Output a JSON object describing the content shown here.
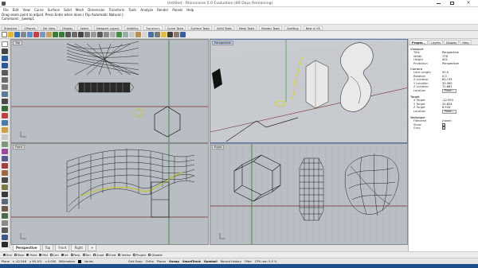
{
  "window": {
    "title": "Untitled - Rhinoceros 5.0 Evaluation (89 Days Remaining)"
  },
  "menu": [
    "File",
    "Edit",
    "View",
    "Curve",
    "Surface",
    "Solid",
    "Mesh",
    "Dimension",
    "Transform",
    "Tools",
    "Analyze",
    "Render",
    "Panels",
    "Help"
  ],
  "command_history": [
    "Drag seam point to adjust. Press Enter when done ( Flip  Automatic  Natural ):",
    "Command: _Sweep1"
  ],
  "toolbar_tabs": [
    "Standard",
    "CPlanes",
    "Set View",
    "Display",
    "Select",
    "Viewport Layout",
    "Visibility",
    "Transform",
    "Curve Tools",
    "Surface Tools",
    "Solid Tools",
    "Mesh Tools",
    "Render Tools",
    "Drafting",
    "New in V5"
  ],
  "viewports": {
    "top": "Top",
    "perspective": "Perspective",
    "front": "Front",
    "right": "Right"
  },
  "viewport_tabs": [
    "Perspective",
    "Top",
    "Front",
    "Right"
  ],
  "panel": {
    "tabs": [
      "Proper...",
      "Layers",
      "Display",
      "Help"
    ],
    "viewport_header": "Viewport",
    "title": {
      "label": "Title",
      "value": "Perspective"
    },
    "width": {
      "label": "Width",
      "value": "776"
    },
    "height": {
      "label": "Height",
      "value": "402"
    },
    "projection": {
      "label": "Projection",
      "value": "Perspective"
    },
    "camera_header": "Camera",
    "lens": {
      "label": "Lens Length",
      "value": "50.0"
    },
    "rotation": {
      "label": "Rotation",
      "value": "0.0"
    },
    "xloc": {
      "label": "X Location",
      "value": "83.135"
    },
    "yloc": {
      "label": "Y Location",
      "value": "33.560"
    },
    "zloc": {
      "label": "Z Location",
      "value": "72.661"
    },
    "location": {
      "label": "Location",
      "button": "Place..."
    },
    "target_header": "Target",
    "xt": {
      "label": "X Target",
      "value": "-12.550"
    },
    "yt": {
      "label": "Y Target",
      "value": "20.824"
    },
    "zt": {
      "label": "Z Target",
      "value": "8.534"
    },
    "tlocation": {
      "label": "Location",
      "button": "Place..."
    },
    "wallpaper_header": "Wallpaper",
    "filename": {
      "label": "Filename",
      "value": "(none)"
    },
    "show": {
      "label": "Show"
    },
    "gray": {
      "label": "Gray"
    }
  },
  "osnaps": [
    {
      "label": "End",
      "on": true
    },
    {
      "label": "Near",
      "on": false
    },
    {
      "label": "Point",
      "on": true
    },
    {
      "label": "Mid",
      "on": true
    },
    {
      "label": "Cen",
      "on": false
    },
    {
      "label": "Int",
      "on": true
    },
    {
      "label": "Perp",
      "on": false
    },
    {
      "label": "Tan",
      "on": false
    },
    {
      "label": "Quad",
      "on": false
    },
    {
      "label": "Knot",
      "on": false
    },
    {
      "label": "Vertex",
      "on": false
    },
    {
      "label": "Project",
      "on": false
    },
    {
      "label": "Disable",
      "on": false
    }
  ],
  "status": {
    "cplane": "Plane",
    "x": "x -42.246",
    "y": "y 99.101",
    "z": "z 0.000",
    "units": "Millimeters",
    "layer": "Varies",
    "items": [
      "Grid Snap",
      "Ortho",
      "Planar",
      "Osnap",
      "SmartTrack",
      "Gumball",
      "Record History",
      "Filter",
      "CPU use: 5.9 %"
    ]
  }
}
